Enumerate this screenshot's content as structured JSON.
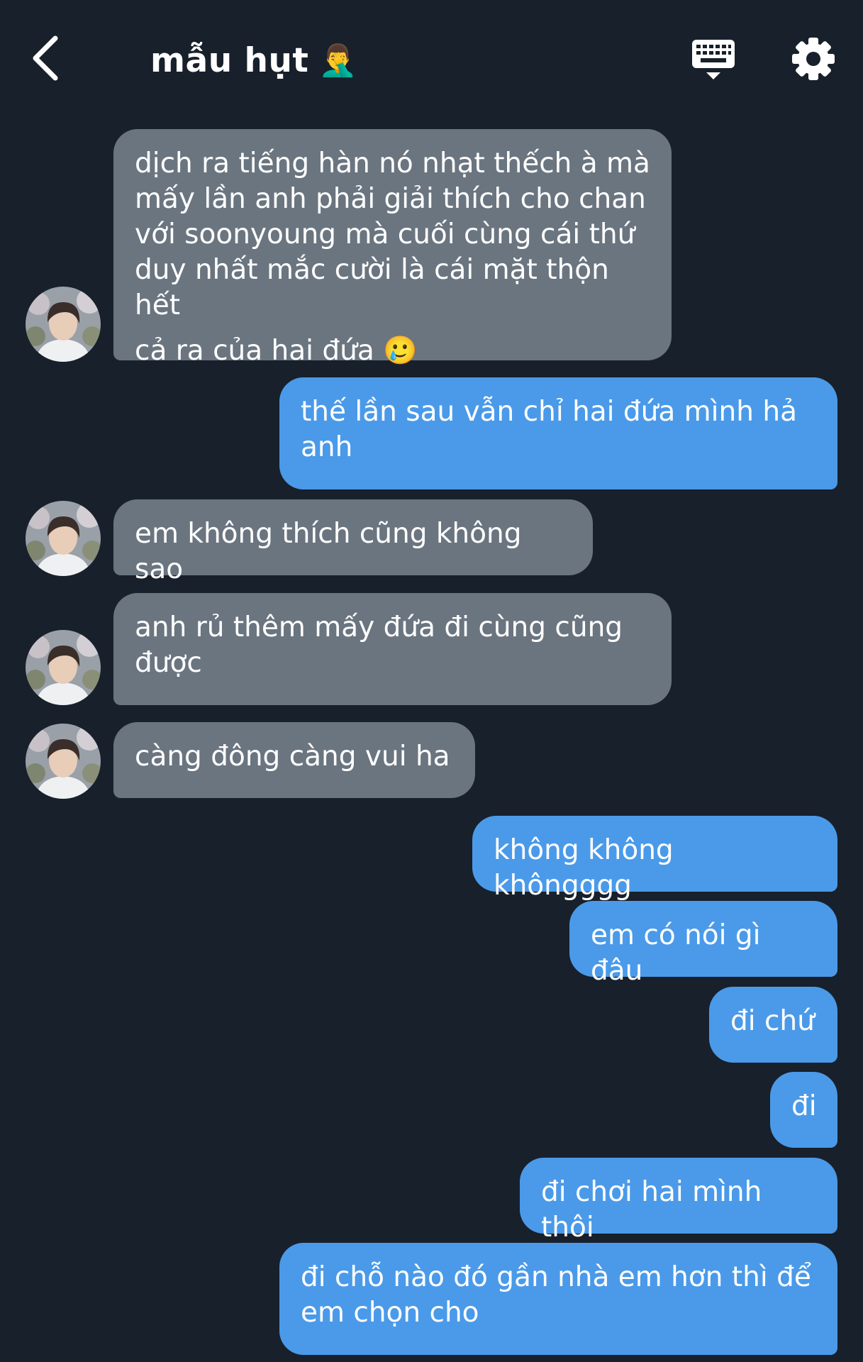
{
  "header": {
    "title": "mẫu hụt",
    "title_emoji": "🤦‍♂️",
    "back_icon": "chevron-left-icon",
    "keyboard_icon": "keyboard-icon",
    "settings_icon": "gear-icon"
  },
  "colors": {
    "background": "#18202b",
    "incoming_bubble": "#6b7580",
    "outgoing_bubble": "#4a9ae9",
    "text": "#ffffff"
  },
  "messages": [
    {
      "side": "in",
      "lines": [
        "dịch ra tiếng hàn nó nhạt thếch à mà",
        "mấy lần anh phải giải thích cho chan",
        "với soonyoung mà cuối cùng cái thứ",
        "duy nhất mắc cười là cái mặt thộn hết",
        "cả ra của hai đứa 🥲"
      ]
    },
    {
      "side": "out",
      "lines": [
        "thế lần sau vẫn chỉ hai đứa mình hả",
        "anh"
      ]
    },
    {
      "side": "in",
      "lines": [
        "em không thích cũng không sao"
      ]
    },
    {
      "side": "in",
      "lines": [
        "anh rủ thêm mấy đứa đi cùng cũng",
        "được"
      ]
    },
    {
      "side": "in",
      "lines": [
        "càng đông càng vui ha"
      ]
    },
    {
      "side": "out",
      "lines": [
        "không không khôngggg"
      ]
    },
    {
      "side": "out",
      "lines": [
        "em có nói gì đâu"
      ]
    },
    {
      "side": "out",
      "lines": [
        "đi chứ"
      ]
    },
    {
      "side": "out",
      "lines": [
        "đi"
      ]
    },
    {
      "side": "out",
      "lines": [
        "đi chơi hai mình thôi"
      ]
    },
    {
      "side": "out",
      "lines": [
        "đi chỗ nào đó gần nhà em hơn thì để",
        "em chọn cho"
      ]
    }
  ]
}
